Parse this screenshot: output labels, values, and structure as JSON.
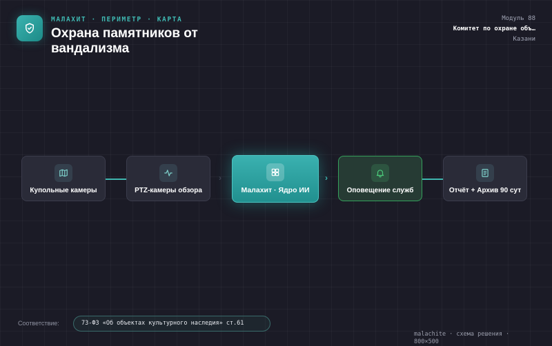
{
  "header": {
    "kicker": "МАЛАХИТ · ПЕРИМЕТР · КАРТА",
    "title": "Охрана памятников от вандализма",
    "meta_line1": "Модуль 88",
    "meta_line2": "Комитет по охране объ…",
    "meta_line3": "Казани"
  },
  "flow": {
    "nodes": [
      {
        "label": "Купольные камеры",
        "icon": "map-icon"
      },
      {
        "label": "PTZ-камеры обзора",
        "icon": "pulse-icon"
      },
      {
        "label": "Малахит · Ядро ИИ",
        "icon": "grid-icon"
      },
      {
        "label": "Оповещение служб",
        "icon": "bell-icon"
      },
      {
        "label": "Отчёт + Архив 90 сут",
        "icon": "document-icon"
      }
    ]
  },
  "footer": {
    "compliance_label": "Соответствие:",
    "compliance_text": "73-ФЗ «Об объектах культурного наследия» ст.61",
    "caption": "malachite · схема решения · 800×500"
  },
  "colors": {
    "accent": "#3fb8b2",
    "core": "#2aa3a1",
    "alert_green": "#35a15c",
    "background": "#1b1b26"
  }
}
